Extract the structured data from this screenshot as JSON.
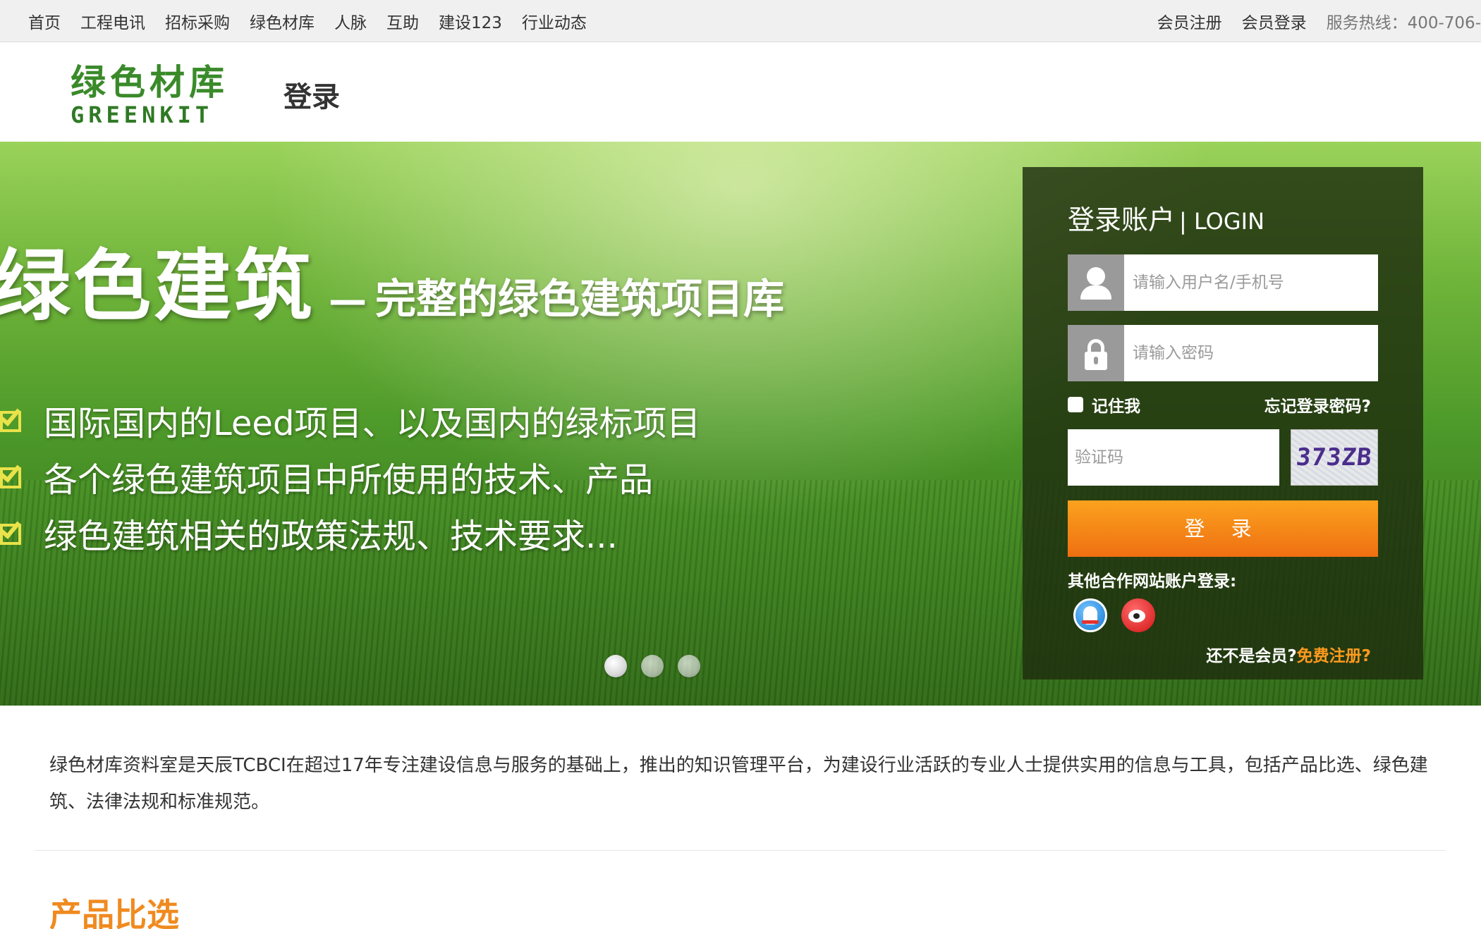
{
  "topnav": {
    "items": [
      "首页",
      "工程电讯",
      "招标采购",
      "绿色材库",
      "人脉",
      "互助",
      "建设123",
      "行业动态"
    ],
    "register": "会员注册",
    "login": "会员登录",
    "hotline": "服务热线：400-706-"
  },
  "header": {
    "logo_cn": "绿色材库",
    "logo_en": "GREENKIT",
    "page_title": "登录"
  },
  "banner": {
    "title_big": "绿色建筑",
    "title_dash": "—",
    "title_sub": "完整的绿色建筑项目库",
    "features": [
      "国际国内的Leed项目、以及国内的绿标项目",
      "各个绿色建筑项目中所使用的技术、产品",
      "绿色建筑相关的政策法规、技术要求..."
    ],
    "slide_count": 3,
    "active_slide": 1
  },
  "login": {
    "title_cn": "登录账户",
    "title_en": "| LOGIN",
    "username_placeholder": "请输入用户名/手机号",
    "password_placeholder": "请输入密码",
    "remember_label": "记住我",
    "forgot_label": "忘记登录密码?",
    "captcha_placeholder": "验证码",
    "captcha_text": "373ZB",
    "submit_label": "登 录",
    "partner_label": "其他合作网站账户登录:",
    "partner_icons": [
      "qq-icon",
      "weibo-icon"
    ],
    "signup_question": "还不是会员?",
    "signup_link": "免费注册?"
  },
  "intro": {
    "text": "绿色材库资料室是天辰TCBCI在超过17年专注建设信息与服务的基础上，推出的知识管理平台，为建设行业活跃的专业人士提供实用的信息与工具，包括产品比选、绿色建筑、法律法规和标准规范。"
  },
  "section": {
    "title": "产品比选"
  },
  "colors": {
    "accent_orange": "#f08a1f",
    "brand_green": "#3a8a2a",
    "panel_bg": "#1e2d0f",
    "button_orange": "#ef6f12"
  }
}
